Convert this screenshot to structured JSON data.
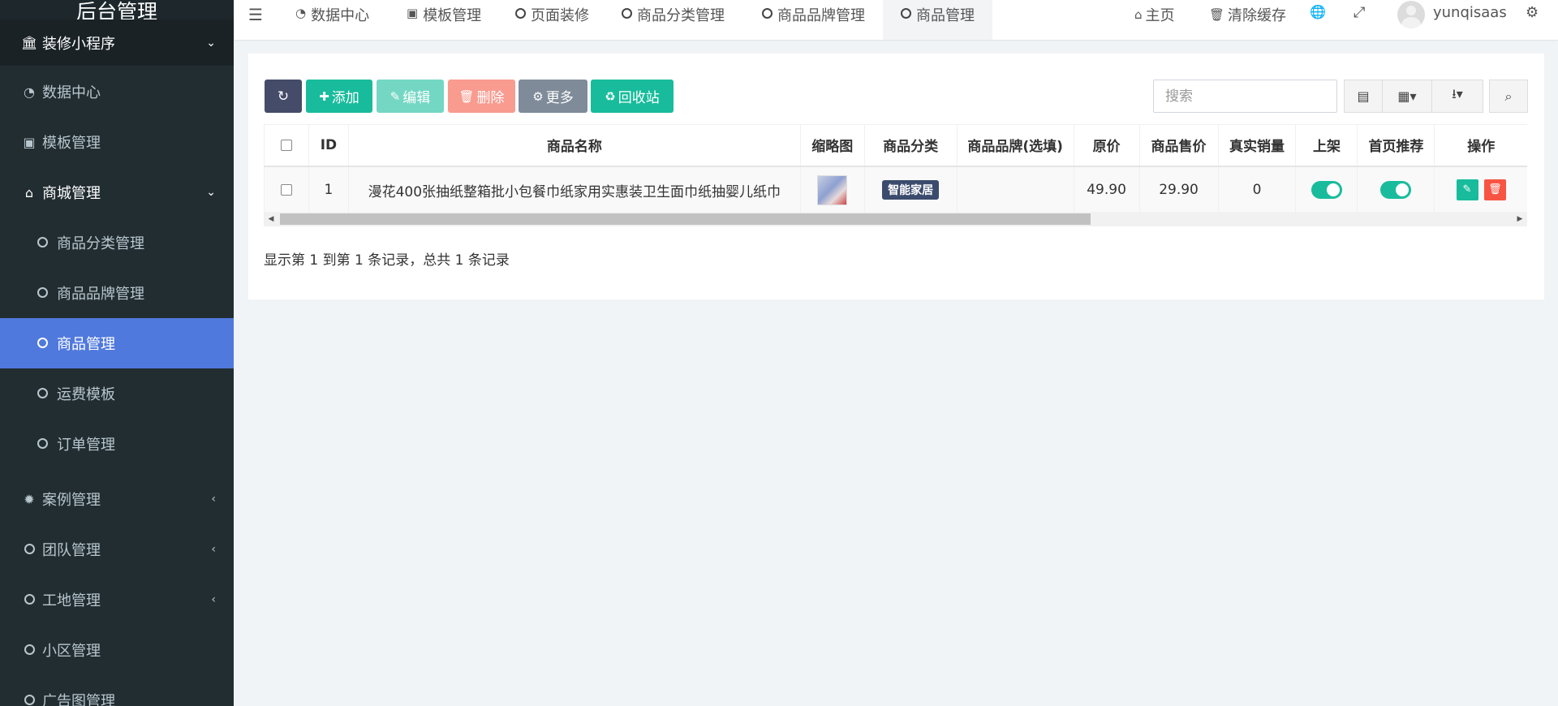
{
  "sidebar": {
    "logo": "后台管理",
    "items": [
      {
        "label": "装修小程序",
        "icon": "building-icon"
      },
      {
        "label": "数据中心",
        "icon": "dashboard-icon"
      },
      {
        "label": "模板管理",
        "icon": "template-icon"
      },
      {
        "label": "商城管理",
        "icon": "home-icon"
      },
      {
        "label": "商品分类管理",
        "icon": "circle-icon"
      },
      {
        "label": "商品品牌管理",
        "icon": "circle-icon"
      },
      {
        "label": "商品管理",
        "icon": "circle-icon"
      },
      {
        "label": "运费模板",
        "icon": "circle-icon"
      },
      {
        "label": "订单管理",
        "icon": "circle-icon"
      },
      {
        "label": "案例管理",
        "icon": "gear-icon"
      },
      {
        "label": "团队管理",
        "icon": "circle-icon"
      },
      {
        "label": "工地管理",
        "icon": "circle-icon"
      },
      {
        "label": "小区管理",
        "icon": "circle-icon"
      },
      {
        "label": "广告图管理",
        "icon": "circle-icon"
      }
    ]
  },
  "topbar": {
    "tabs": [
      {
        "label": "数据中心",
        "icon": "dashboard-icon"
      },
      {
        "label": "模板管理",
        "icon": "template-icon"
      },
      {
        "label": "页面装修",
        "icon": "circle-icon"
      },
      {
        "label": "商品分类管理",
        "icon": "circle-icon"
      },
      {
        "label": "商品品牌管理",
        "icon": "circle-icon"
      },
      {
        "label": "商品管理",
        "icon": "circle-icon"
      }
    ],
    "home": "主页",
    "clear_cache": "清除缓存",
    "username": "yunqisaas"
  },
  "toolbar": {
    "add": "添加",
    "edit": "编辑",
    "delete": "删除",
    "more": "更多",
    "recycle": "回收站",
    "search_placeholder": "搜索"
  },
  "table": {
    "columns": [
      "ID",
      "商品名称",
      "缩略图",
      "商品分类",
      "商品品牌(选填)",
      "原价",
      "商品售价",
      "真实销量",
      "上架",
      "首页推荐",
      "操作"
    ],
    "rows": [
      {
        "id": "1",
        "name": "漫花400张抽纸整箱批小包餐巾纸家用实惠装卫生面巾纸抽婴儿纸巾",
        "category": "智能家居",
        "brand": "",
        "original_price": "49.90",
        "sale_price": "29.90",
        "sales": "0",
        "on_shelf": true,
        "recommend": true
      }
    ]
  },
  "pager": {
    "info": "显示第 1 到第 1 条记录，总共 1 条记录"
  },
  "colors": {
    "sidebar_bg": "#222d32",
    "active": "#5079dd",
    "success": "#18bc9c",
    "danger": "#f75444"
  }
}
